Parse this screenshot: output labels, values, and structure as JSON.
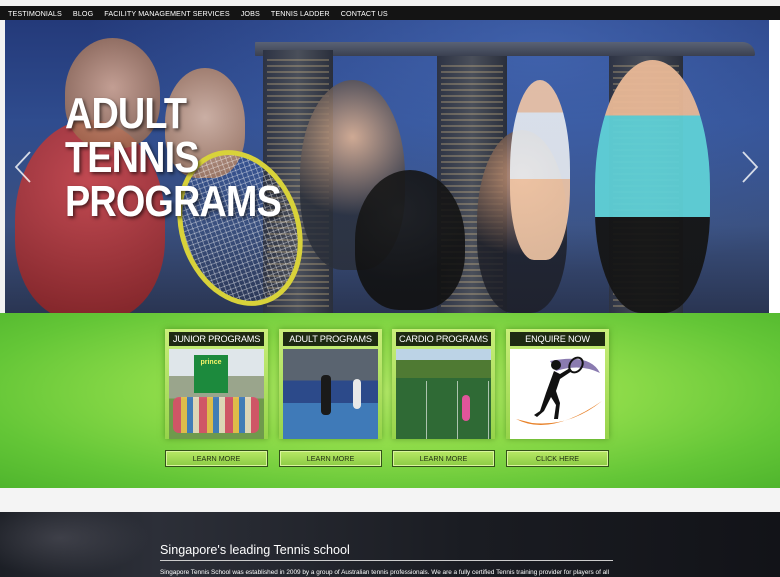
{
  "nav": {
    "items": [
      "TESTIMONIALS",
      "BLOG",
      "FACILITY MANAGEMENT SERVICES",
      "JOBS",
      "TENNIS LADDER",
      "CONTACT US"
    ]
  },
  "hero": {
    "title_lines": [
      "ADULT",
      "TENNIS",
      "PROGRAMS"
    ],
    "prev_icon": "chevron-left-icon",
    "next_icon": "chevron-right-icon"
  },
  "cards": [
    {
      "heading": "JUNIOR PROGRAMS",
      "button": "LEARN MORE",
      "badge": "prince"
    },
    {
      "heading": "ADULT PROGRAMS",
      "button": "LEARN MORE"
    },
    {
      "heading": "CARDIO PROGRAMS",
      "button": "LEARN MORE"
    },
    {
      "heading": "ENQUIRE NOW",
      "button": "CLICK HERE"
    }
  ],
  "about": {
    "title": "Singapore's leading Tennis school",
    "text": "Singapore Tennis School was established in 2009 by a group of Australian tennis professionals. We are a fully certified Tennis training provider for players of all"
  },
  "colors": {
    "nav_bg": "#141414",
    "accent_green": "#8fdc4a",
    "card_head": "#1e2a12",
    "footer_bg": "#1c1f26"
  }
}
